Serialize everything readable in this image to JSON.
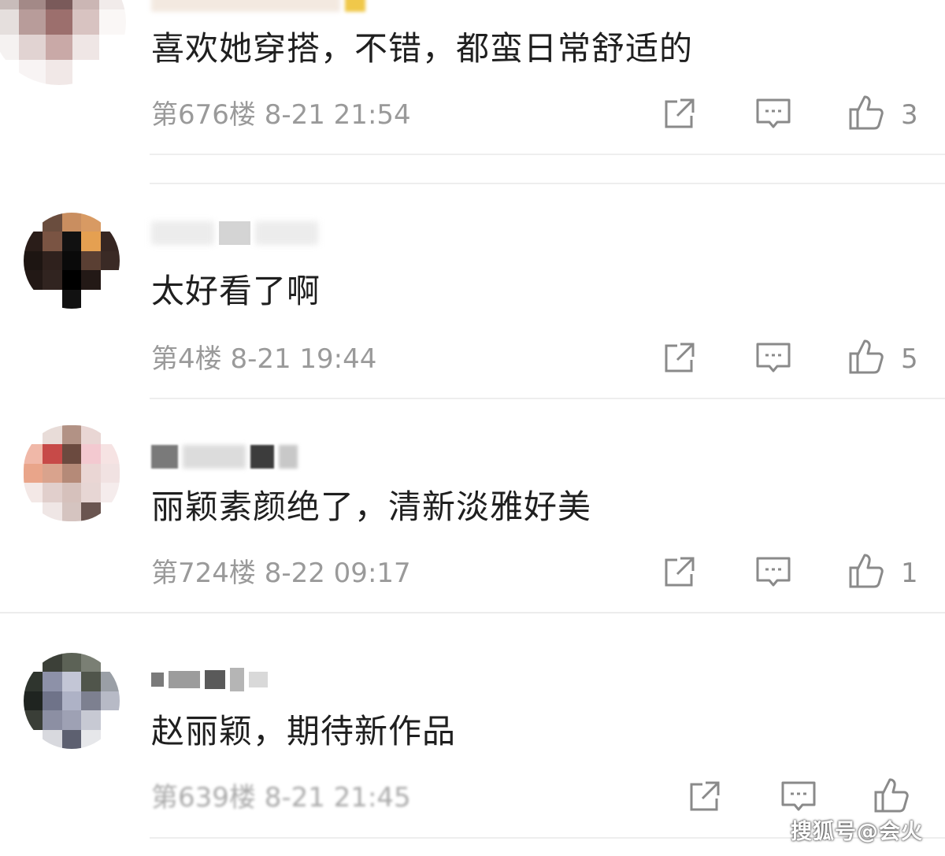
{
  "comments": [
    {
      "text": "喜欢她穿搭，不错，都蛮日常舒适的",
      "meta": "第676楼 8-21 21:54",
      "likes": "3"
    },
    {
      "text": "太好看了啊",
      "meta": "第4楼 8-21 19:44",
      "likes": "5"
    },
    {
      "text": "丽颖素颜绝了，清新淡雅好美",
      "meta": "第724楼 8-22 09:17",
      "likes": "1"
    },
    {
      "text": "赵丽颖，期待新作品",
      "meta": "第639楼 8-21 21:45",
      "likes": ""
    }
  ],
  "icons": {
    "share": "share-icon",
    "reply": "comment-icon",
    "like": "thumbs-up-icon"
  },
  "colors": {
    "text": "#1f1f1f",
    "meta": "#9a9a9a",
    "icon": "#8a8a8a",
    "divider": "#eeeeee"
  },
  "watermark": "搜狐号@会火"
}
